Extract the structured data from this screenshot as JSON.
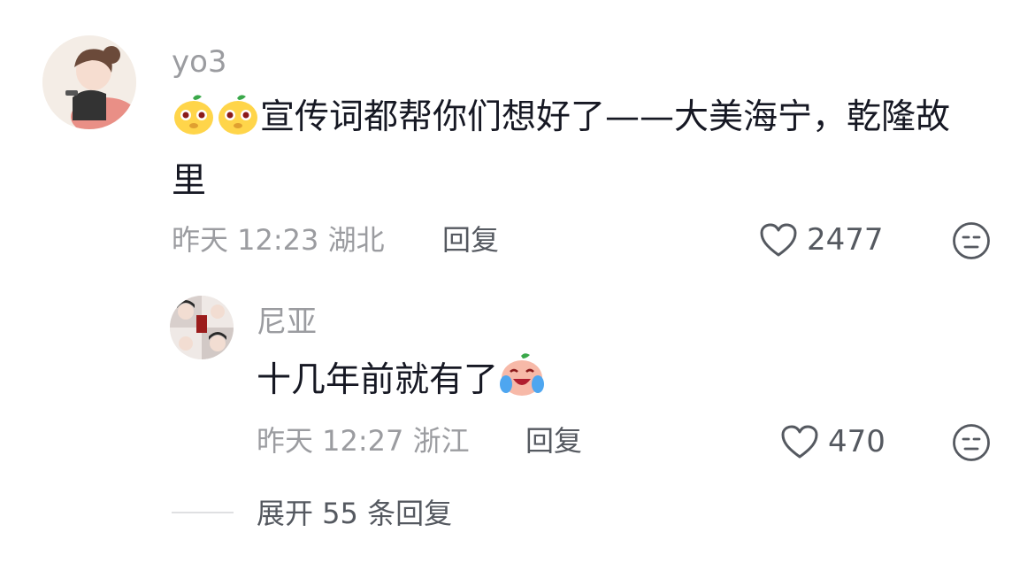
{
  "comment": {
    "username": "yo3",
    "text_line1": "宣传词都帮你们想好了——大美海宁，乾隆故",
    "text_line2": "里",
    "emoji_count": 2,
    "time": "昨天 12:23",
    "location": "湖北",
    "reply_label": "回复",
    "likes": "2477"
  },
  "reply": {
    "username": "尼亚",
    "text": "十几年前就有了",
    "time": "昨天 12:27",
    "location": "浙江",
    "reply_label": "回复",
    "likes": "470"
  },
  "expand_label": "展开 55 条回复",
  "icons": {
    "heart": "heart-icon",
    "dislike": "meh-face-icon",
    "emoji_1": "pig-emoji",
    "emoji_2": "crying-laugh-emoji"
  }
}
